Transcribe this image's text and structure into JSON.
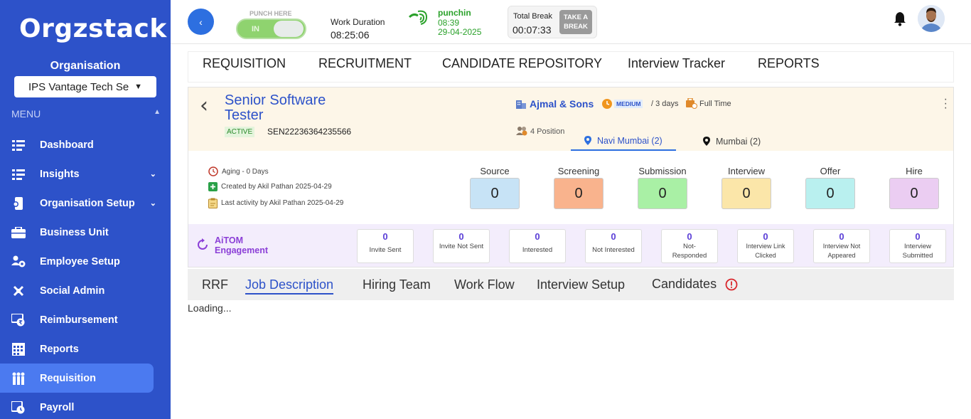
{
  "app": {
    "logo": "Orgzstack"
  },
  "sidebar": {
    "org_label": "Organisation",
    "org_selected": "IPS Vantage Tech Se",
    "menu_label": "MENU",
    "items": [
      {
        "label": "Dashboard",
        "icon": "dashboard-icon"
      },
      {
        "label": "Insights",
        "icon": "insights-icon",
        "expandable": true
      },
      {
        "label": "Organisation Setup",
        "icon": "org-setup-icon",
        "expandable": true
      },
      {
        "label": "Business Unit",
        "icon": "briefcase-icon"
      },
      {
        "label": "Employee Setup",
        "icon": "employee-icon"
      },
      {
        "label": "Social Admin",
        "icon": "social-icon"
      },
      {
        "label": "Reimbursement",
        "icon": "reimbursement-icon"
      },
      {
        "label": "Reports",
        "icon": "reports-icon"
      },
      {
        "label": "Requisition",
        "icon": "requisition-icon",
        "active": true
      },
      {
        "label": "Payroll",
        "icon": "payroll-icon"
      }
    ]
  },
  "topbar": {
    "punch_here": "PUNCH HERE",
    "punch_state": "IN",
    "work_duration_label": "Work Duration",
    "work_duration": "08:25:06",
    "punchin_label": "punchin",
    "punchin_time": "08:39",
    "punchin_date": "29-04-2025",
    "total_break_label": "Total Break",
    "total_break": "00:07:33",
    "take_break_line1": "TAKE A",
    "take_break_line2": "BREAK"
  },
  "main_nav": [
    "REQUISITION",
    "RECRUITMENT",
    "CANDIDATE REPOSITORY",
    "Interview Tracker",
    "REPORTS"
  ],
  "job": {
    "title": "Senior Software Tester",
    "status": "ACTIVE",
    "code": "SEN22236364235566",
    "company": "Ajmal & Sons",
    "priority": "MEDIUM",
    "days": "/ 3 days",
    "employment_type": "Full Time",
    "positions": "4 Position",
    "locations": [
      "Navi Mumbai (2)",
      "Mumbai (2)"
    ],
    "aging": "Aging - 0 Days",
    "created_by": "Created by Akil Pathan 2025-04-29",
    "last_activity": "Last activity by Akil Pathan 2025-04-29"
  },
  "stages": [
    {
      "label": "Source",
      "value": "0",
      "color": "#c7e3f6"
    },
    {
      "label": "Screening",
      "value": "0",
      "color": "#f9b38d"
    },
    {
      "label": "Submission",
      "value": "0",
      "color": "#a9f0a5"
    },
    {
      "label": "Interview",
      "value": "0",
      "color": "#fbe6a9"
    },
    {
      "label": "Offer",
      "value": "0",
      "color": "#b9f0ef"
    },
    {
      "label": "Hire",
      "value": "0",
      "color": "#ebcdf2"
    }
  ],
  "aitom": {
    "title_line1": "AiTOM",
    "title_line2": "Engagement",
    "items": [
      {
        "value": "0",
        "label": "Invite Sent"
      },
      {
        "value": "0",
        "label": "Invite Not Sent"
      },
      {
        "value": "0",
        "label": "Interested"
      },
      {
        "value": "0",
        "label": "Not Interested"
      },
      {
        "value": "0",
        "label": "Not-Responded"
      },
      {
        "value": "0",
        "label": "Interview Link Clicked"
      },
      {
        "value": "0",
        "label": "Interview Not Appeared"
      },
      {
        "value": "0",
        "label": "Interview Submitted"
      }
    ]
  },
  "sub_tabs": [
    "RRF",
    "Job Description",
    "Hiring Team",
    "Work Flow",
    "Interview Setup",
    "Candidates"
  ],
  "loading_text": "Loading..."
}
